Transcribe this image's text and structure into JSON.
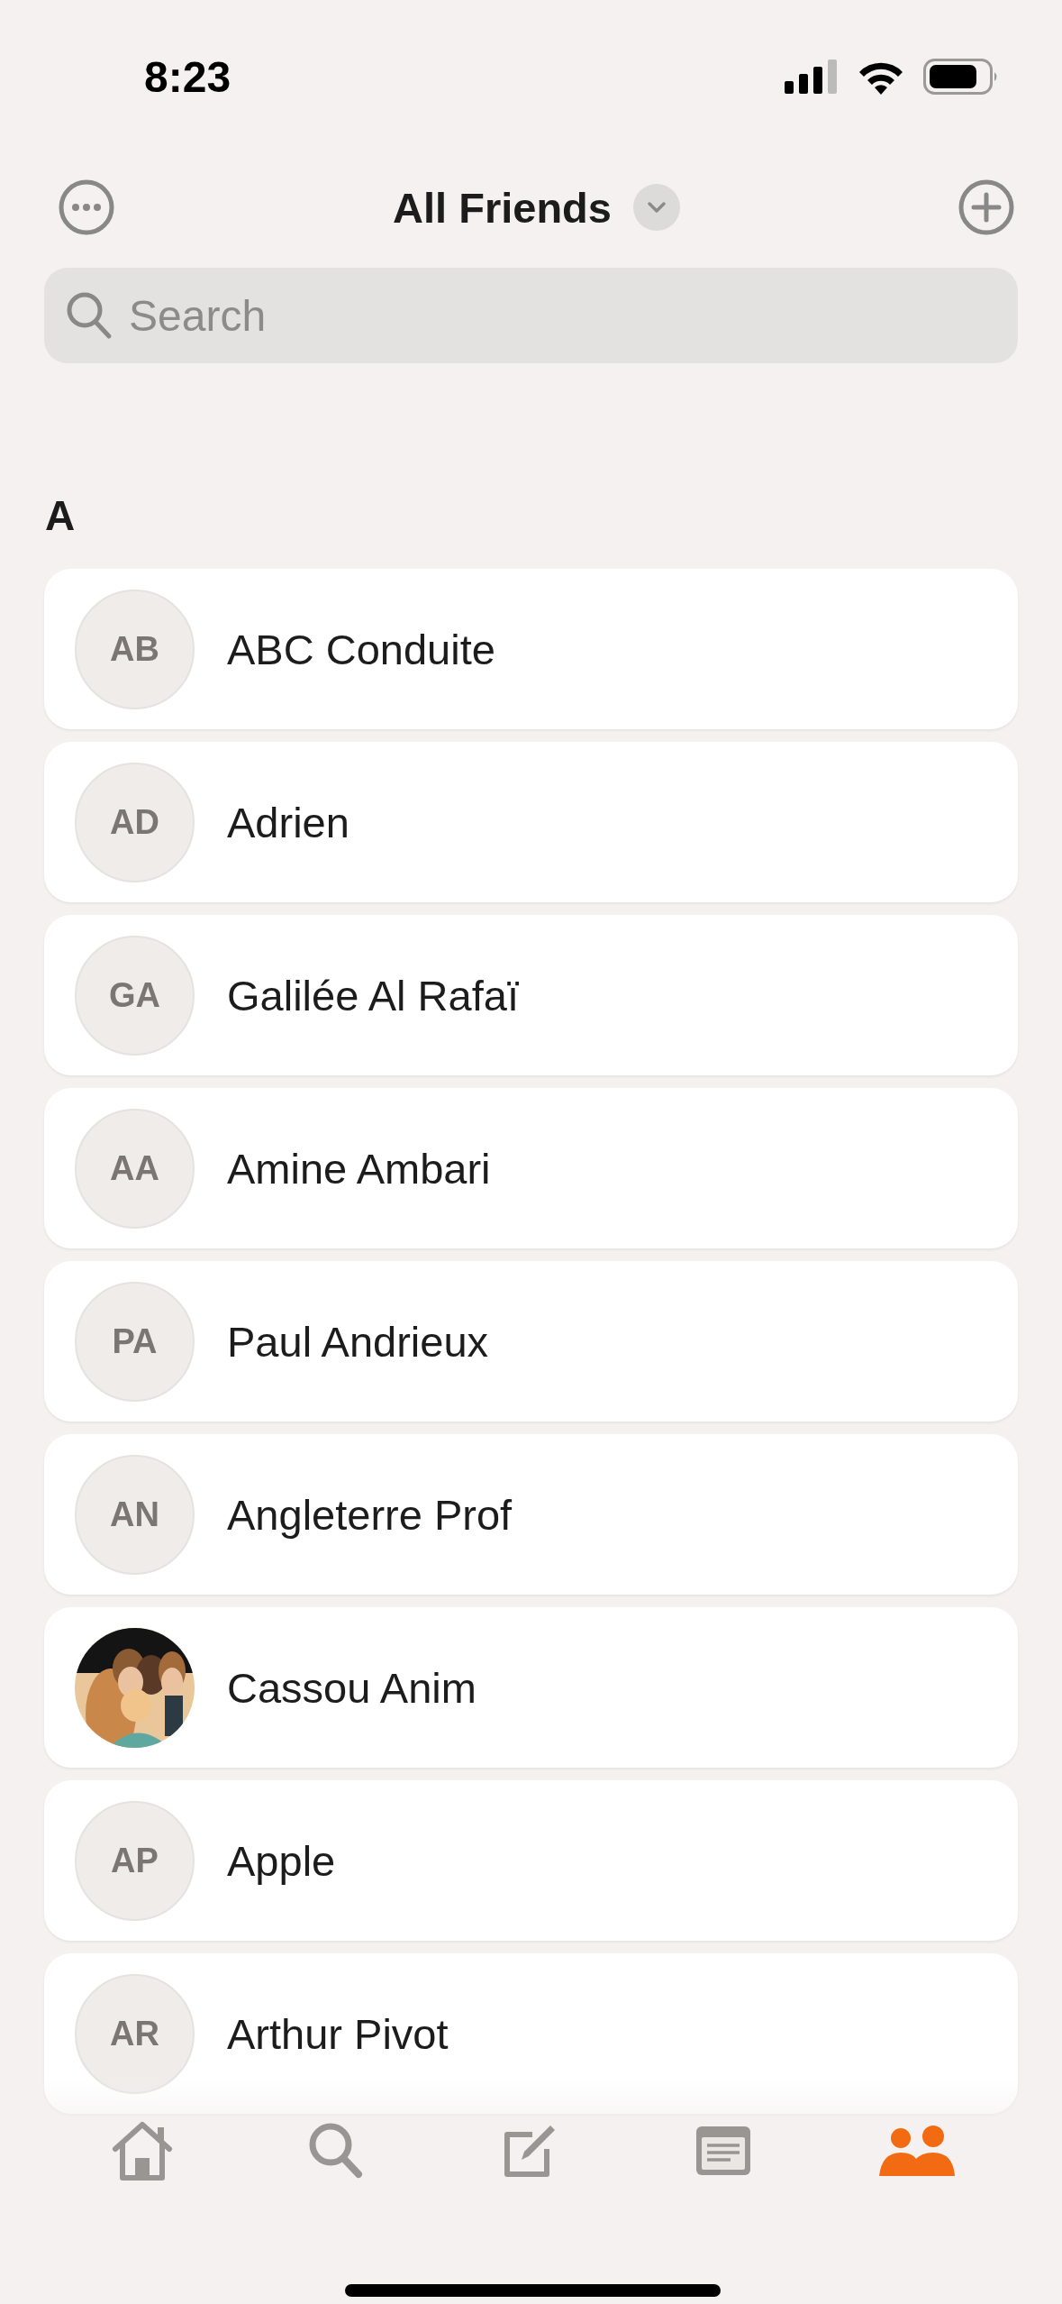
{
  "status_bar": {
    "time": "8:23"
  },
  "header": {
    "title": "All Friends"
  },
  "search": {
    "placeholder": "Search"
  },
  "sections": [
    {
      "letter": "A",
      "friends": [
        {
          "name": "ABC Conduite",
          "avatar": {
            "kind": "initials",
            "initials": "AB"
          }
        },
        {
          "name": "Adrien",
          "avatar": {
            "kind": "initials",
            "initials": "AD"
          }
        },
        {
          "name": "Galilée Al Rafaï",
          "avatar": {
            "kind": "initials",
            "initials": "GA"
          }
        },
        {
          "name": "Amine Ambari",
          "avatar": {
            "kind": "initials",
            "initials": "AA"
          }
        },
        {
          "name": "Paul Andrieux",
          "avatar": {
            "kind": "initials",
            "initials": "PA"
          }
        },
        {
          "name": "Angleterre Prof",
          "avatar": {
            "kind": "initials",
            "initials": "AN"
          }
        },
        {
          "name": "Cassou Anim"
        },
        {
          "name": "Apple",
          "avatar": {
            "kind": "initials",
            "initials": "AP"
          }
        },
        {
          "name": "Arthur Pivot",
          "avatar": {
            "kind": "initials",
            "initials": "AR"
          }
        }
      ]
    }
  ],
  "tabs": [
    {
      "kind": "home",
      "selected": false
    },
    {
      "kind": "search",
      "selected": false
    },
    {
      "kind": "compose",
      "selected": false
    },
    {
      "kind": "feed",
      "selected": false
    },
    {
      "kind": "friends",
      "selected": true
    }
  ]
}
